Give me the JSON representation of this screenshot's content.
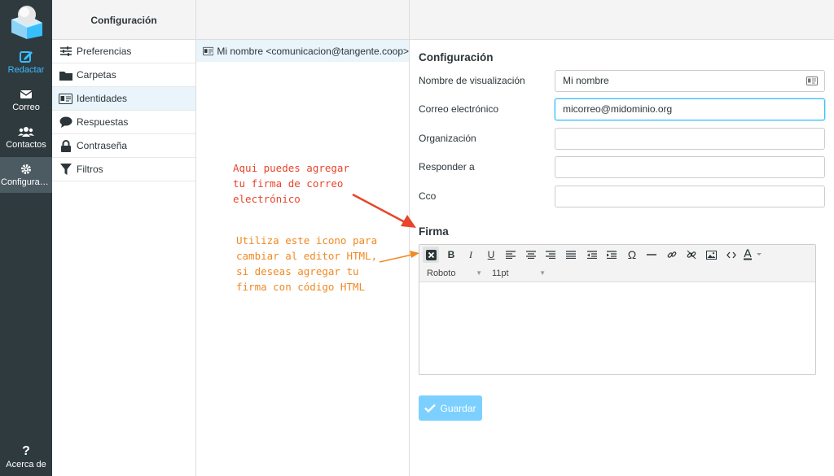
{
  "rail": {
    "items": [
      {
        "label": "Redactar",
        "icon": "compose-icon"
      },
      {
        "label": "Correo",
        "icon": "mail-icon"
      },
      {
        "label": "Contactos",
        "icon": "contacts-icon"
      },
      {
        "label": "Configuraci...",
        "icon": "gear-icon"
      },
      {
        "label": "Acerca de",
        "icon": "question-icon"
      }
    ]
  },
  "settings": {
    "header": "Configuración",
    "items": [
      {
        "label": "Preferencias",
        "icon": "sliders-icon"
      },
      {
        "label": "Carpetas",
        "icon": "folder-icon"
      },
      {
        "label": "Identidades",
        "icon": "id-card-icon"
      },
      {
        "label": "Respuestas",
        "icon": "speech-bubble-icon"
      },
      {
        "label": "Contraseña",
        "icon": "lock-icon"
      },
      {
        "label": "Filtros",
        "icon": "filter-icon"
      }
    ]
  },
  "identities": {
    "items": [
      {
        "label": "Mi nombre <comunicacion@tangente.coop>"
      }
    ]
  },
  "form": {
    "section_title": "Configuración",
    "fields": [
      {
        "label": "Nombre de visualización",
        "value": "Mi nombre"
      },
      {
        "label": "Correo electrónico",
        "value": "micorreo@midominio.org"
      },
      {
        "label": "Organización",
        "value": ""
      },
      {
        "label": "Responder a",
        "value": ""
      },
      {
        "label": "Cco",
        "value": ""
      }
    ],
    "signature_title": "Firma",
    "editor": {
      "font": "Roboto",
      "size": "11pt",
      "buttons": [
        "B",
        "I",
        "U",
        "Ω"
      ]
    },
    "save_label": "Guardar"
  },
  "annotations": {
    "signature_note": "Aqui puedes agregar\ntu firma de correo\nelectrónico",
    "html_note": "Utiliza este icono para\ncambiar al editor HTML,\nsi deseas agregar tu\nfirma con código HTML"
  },
  "colors": {
    "rail_bg": "#2f3a3f",
    "accent": "#37beff",
    "annotation_red": "#e8452c",
    "annotation_orange": "#f08a24"
  }
}
